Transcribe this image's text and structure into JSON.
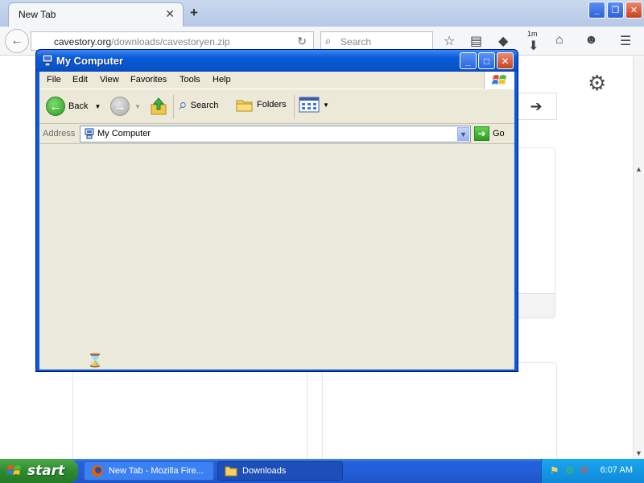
{
  "firefox": {
    "tab_title": "New Tab",
    "tab_close": "✕",
    "new_tab": "+",
    "url_host": "cavestory.org",
    "url_path": "/downloads/cavestoryen.zip",
    "search_placeholder": "Search",
    "downloads_badge": "1m"
  },
  "explorer": {
    "title": "My Computer",
    "menu": [
      "File",
      "Edit",
      "View",
      "Favorites",
      "Tools",
      "Help"
    ],
    "toolbar": {
      "back": "Back",
      "search": "Search",
      "folders": "Folders"
    },
    "address_label": "Address",
    "address_value": "My Computer",
    "go_label": "Go"
  },
  "taskbar": {
    "start_label": "start",
    "tasks": [
      {
        "label": "New Tab - Mozilla Fire...",
        "icon": "firefox-icon",
        "active": false
      },
      {
        "label": "Downloads",
        "icon": "folder-icon",
        "active": true
      }
    ],
    "clock": "6:07 AM"
  },
  "colors": {
    "xp_blue": "#0a5bd7",
    "xp_face": "#ece9d8",
    "start_green": "#2f8a2f",
    "tray_blue": "#0f8ad8"
  }
}
